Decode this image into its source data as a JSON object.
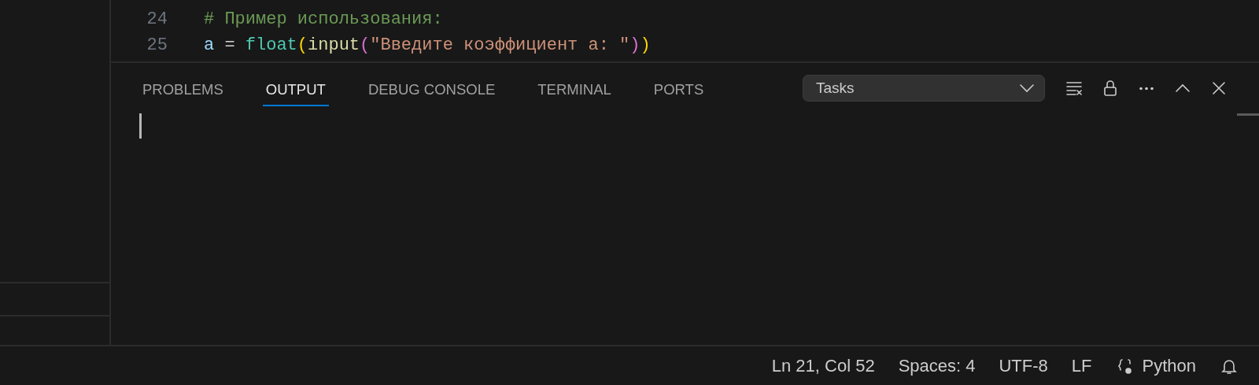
{
  "editor": {
    "lines": [
      {
        "number": "24",
        "tokens": [
          {
            "kind": "comment",
            "text": "# Пример использования:"
          }
        ]
      },
      {
        "number": "25",
        "tokens": [
          {
            "kind": "variable",
            "text": "a"
          },
          {
            "kind": "operator",
            "text": " = "
          },
          {
            "kind": "builtin",
            "text": "float"
          },
          {
            "kind": "bracket1",
            "text": "("
          },
          {
            "kind": "function",
            "text": "input"
          },
          {
            "kind": "bracket2",
            "text": "("
          },
          {
            "kind": "string",
            "text": "\"Введите коэффициент а: \""
          },
          {
            "kind": "bracket2",
            "text": ")"
          },
          {
            "kind": "bracket1",
            "text": ")"
          }
        ]
      }
    ]
  },
  "panel": {
    "tabs": [
      {
        "label": "PROBLEMS",
        "selected": false
      },
      {
        "label": "OUTPUT",
        "selected": true
      },
      {
        "label": "DEBUG CONSOLE",
        "selected": false
      },
      {
        "label": "TERMINAL",
        "selected": false
      },
      {
        "label": "PORTS",
        "selected": false
      }
    ],
    "channel_select": {
      "value": "Tasks"
    }
  },
  "status_bar": {
    "items": [
      {
        "kind": "text",
        "label": "Ln 21, Col 52"
      },
      {
        "kind": "text",
        "label": "Spaces: 4"
      },
      {
        "kind": "text",
        "label": "UTF-8"
      },
      {
        "kind": "text",
        "label": "LF"
      },
      {
        "kind": "language",
        "label": "Python"
      },
      {
        "kind": "bell"
      }
    ]
  }
}
